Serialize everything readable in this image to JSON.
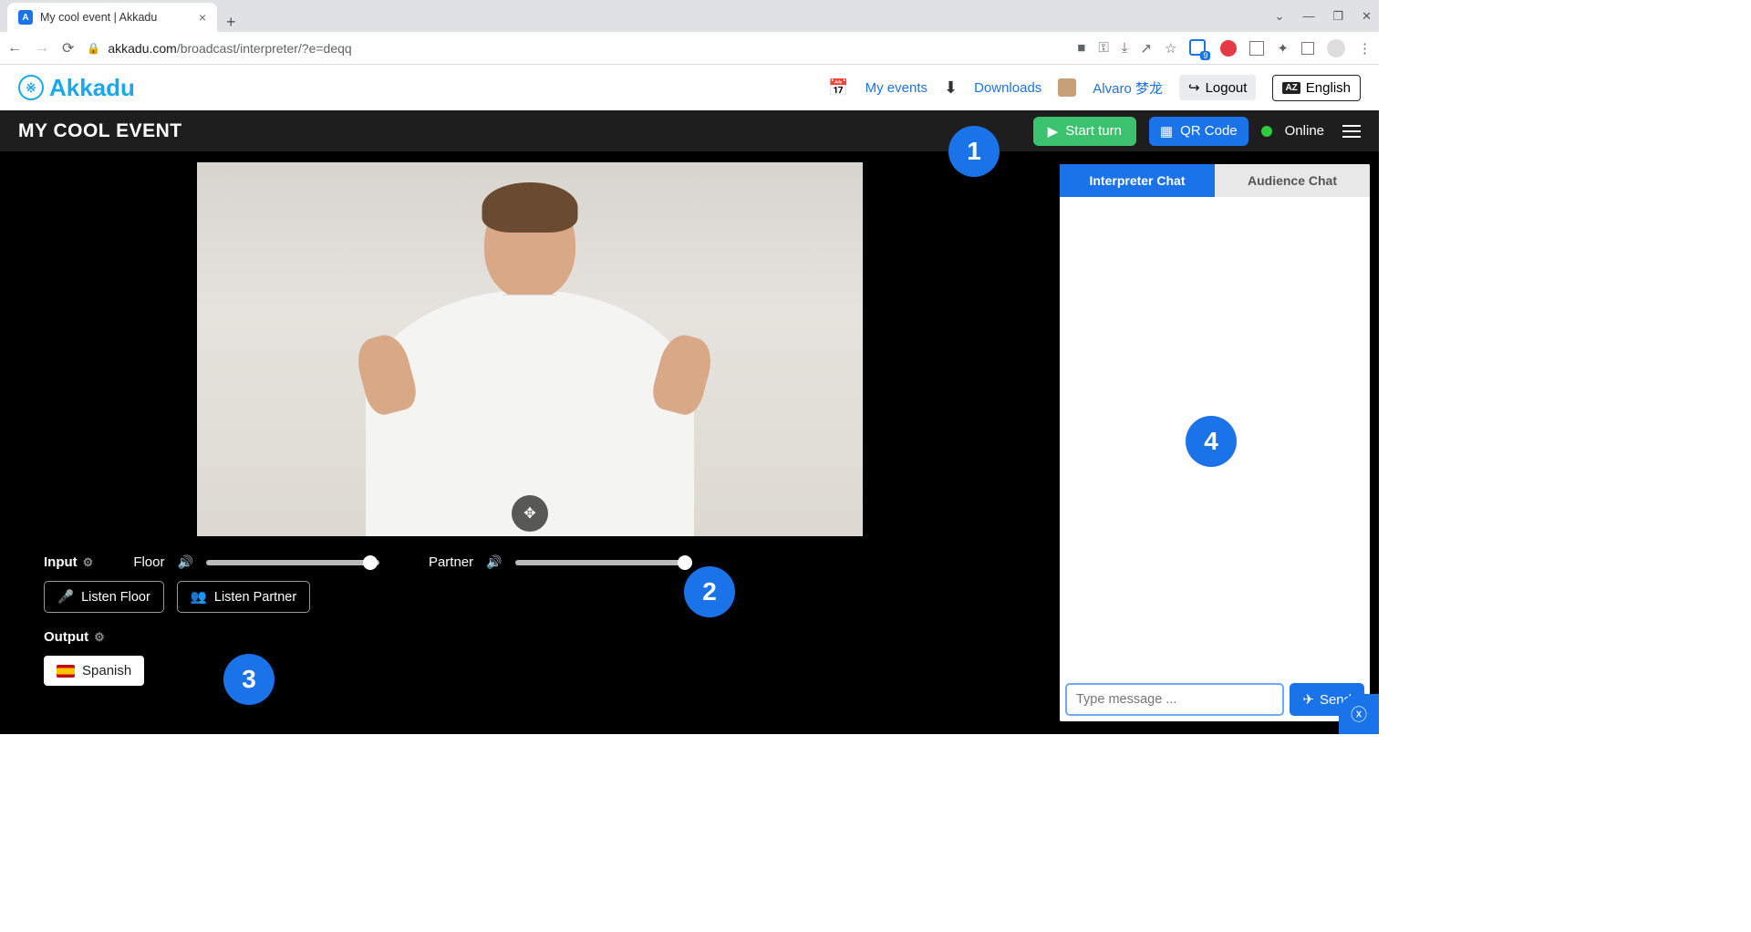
{
  "browser": {
    "tab_title": "My cool event | Akkadu",
    "url_domain": "akkadu.com",
    "url_path": "/broadcast/interpreter/?e=deqq",
    "badge_count": "9"
  },
  "app_header": {
    "brand": "Akkadu",
    "my_events": "My events",
    "downloads": "Downloads",
    "user_name": "Alvaro 梦龙",
    "logout": "Logout",
    "language": "English",
    "lang_badge": "AZ"
  },
  "dark_bar": {
    "event_title": "MY COOL EVENT",
    "start_turn": "Start turn",
    "qr_code": "QR Code",
    "online": "Online"
  },
  "controls": {
    "input_label": "Input",
    "floor_label": "Floor",
    "partner_label": "Partner",
    "listen_floor": "Listen Floor",
    "listen_partner": "Listen Partner",
    "output_label": "Output",
    "output_language": "Spanish",
    "floor_slider_pct": 95,
    "partner_slider_pct": 98
  },
  "chat": {
    "tab_interpreter": "Interpreter Chat",
    "tab_audience": "Audience Chat",
    "placeholder": "Type message ...",
    "send": "Send"
  },
  "annotations": {
    "b1": "1",
    "b2": "2",
    "b3": "3",
    "b4": "4"
  }
}
